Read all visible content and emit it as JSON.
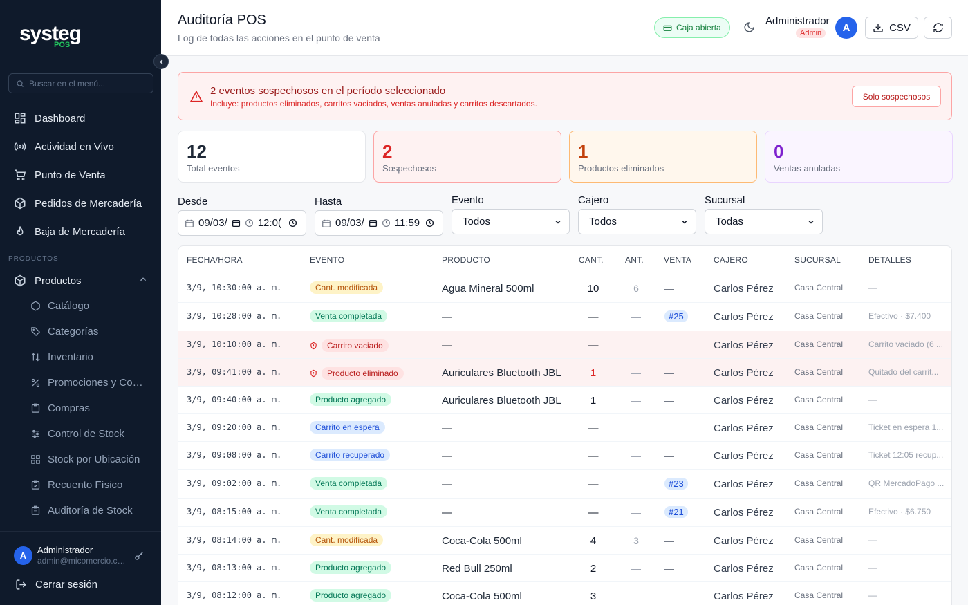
{
  "sidebar": {
    "logo_brand": "systeg",
    "logo_sub": "POS",
    "search_placeholder": "Buscar en el menú...",
    "nav": [
      "Dashboard",
      "Actividad en Vivo",
      "Punto de Venta",
      "Pedidos de Mercadería",
      "Baja de Mercadería"
    ],
    "section_label": "PRODUCTOS",
    "group_label": "Productos",
    "sub_items": [
      "Catálogo",
      "Categorías",
      "Inventario",
      "Promociones y Combos",
      "Compras",
      "Control de Stock",
      "Stock por Ubicación",
      "Recuento Físico",
      "Auditoría de Stock"
    ],
    "footer": {
      "avatar": "A",
      "name": "Administrador",
      "email": "admin@micomercio.com",
      "logout": "Cerrar sesión"
    }
  },
  "header": {
    "title": "Auditoría POS",
    "subtitle": "Log de todas las acciones en el punto de venta",
    "caja_label": "Caja abierta",
    "user_name": "Administrador",
    "user_role": "Admin",
    "avatar": "A",
    "csv_label": "CSV"
  },
  "alert": {
    "title": "2 eventos sospechosos en el período seleccionado",
    "text": "Incluye: productos eliminados, carritos vaciados, ventas anuladas y carritos descartados.",
    "button": "Solo sospechosos"
  },
  "stats": [
    {
      "value": "12",
      "label": "Total eventos",
      "color": "#1f2937"
    },
    {
      "value": "2",
      "label": "Sospechosos",
      "color": "#dc2626"
    },
    {
      "value": "1",
      "label": "Productos eliminados",
      "color": "#c2410c"
    },
    {
      "value": "0",
      "label": "Ventas anuladas",
      "color": "#7e22ce"
    }
  ],
  "filters": {
    "desde_label": "Desde",
    "desde_date": "09/03/",
    "desde_time": "12:0(",
    "hasta_label": "Hasta",
    "hasta_date": "09/03/",
    "hasta_time": "11:59",
    "evento_label": "Evento",
    "evento_value": "Todos",
    "cajero_label": "Cajero",
    "cajero_value": "Todos",
    "sucursal_label": "Sucursal",
    "sucursal_value": "Todas"
  },
  "table": {
    "headers": [
      "FECHA/HORA",
      "EVENTO",
      "PRODUCTO",
      "CANT.",
      "ANT.",
      "VENTA",
      "CAJERO",
      "SUCURSAL",
      "DETALLES"
    ],
    "rows": [
      {
        "date": "3/9, 10:30:00 a. m.",
        "event": "Cant. modificada",
        "ev_color": "yellow",
        "shield": false,
        "susp": false,
        "product": "Agua Mineral 500ml",
        "cant": "10",
        "cant_red": false,
        "ant": "6",
        "venta": "—",
        "venta_pill": false,
        "cajero": "Carlos Pérez",
        "sucursal": "Casa Central",
        "detalles": "—"
      },
      {
        "date": "3/9, 10:28:00 a. m.",
        "event": "Venta completada",
        "ev_color": "green",
        "shield": false,
        "susp": false,
        "product": "—",
        "cant": "—",
        "cant_red": false,
        "ant": "—",
        "venta": "#25",
        "venta_pill": true,
        "cajero": "Carlos Pérez",
        "sucursal": "Casa Central",
        "detalles": "Efectivo · $7.400"
      },
      {
        "date": "3/9, 10:10:00 a. m.",
        "event": "Carrito vaciado",
        "ev_color": "red",
        "shield": true,
        "susp": true,
        "product": "—",
        "cant": "—",
        "cant_red": false,
        "ant": "—",
        "venta": "—",
        "venta_pill": false,
        "cajero": "Carlos Pérez",
        "sucursal": "Casa Central",
        "detalles": "Carrito vaciado (6 ..."
      },
      {
        "date": "3/9, 09:41:00 a. m.",
        "event": "Producto eliminado",
        "ev_color": "red",
        "shield": true,
        "susp": true,
        "product": "Auriculares Bluetooth JBL",
        "cant": "1",
        "cant_red": true,
        "ant": "—",
        "venta": "—",
        "venta_pill": false,
        "cajero": "Carlos Pérez",
        "sucursal": "Casa Central",
        "detalles": "Quitado del carrit..."
      },
      {
        "date": "3/9, 09:40:00 a. m.",
        "event": "Producto agregado",
        "ev_color": "green",
        "shield": false,
        "susp": false,
        "product": "Auriculares Bluetooth JBL",
        "cant": "1",
        "cant_red": false,
        "ant": "—",
        "venta": "—",
        "venta_pill": false,
        "cajero": "Carlos Pérez",
        "sucursal": "Casa Central",
        "detalles": "—"
      },
      {
        "date": "3/9, 09:20:00 a. m.",
        "event": "Carrito en espera",
        "ev_color": "blue",
        "shield": false,
        "susp": false,
        "product": "—",
        "cant": "—",
        "cant_red": false,
        "ant": "—",
        "venta": "—",
        "venta_pill": false,
        "cajero": "Carlos Pérez",
        "sucursal": "Casa Central",
        "detalles": "Ticket en espera 1..."
      },
      {
        "date": "3/9, 09:08:00 a. m.",
        "event": "Carrito recuperado",
        "ev_color": "blue",
        "shield": false,
        "susp": false,
        "product": "—",
        "cant": "—",
        "cant_red": false,
        "ant": "—",
        "venta": "—",
        "venta_pill": false,
        "cajero": "Carlos Pérez",
        "sucursal": "Casa Central",
        "detalles": "Ticket 12:05 recup..."
      },
      {
        "date": "3/9, 09:02:00 a. m.",
        "event": "Venta completada",
        "ev_color": "green",
        "shield": false,
        "susp": false,
        "product": "—",
        "cant": "—",
        "cant_red": false,
        "ant": "—",
        "venta": "#23",
        "venta_pill": true,
        "cajero": "Carlos Pérez",
        "sucursal": "Casa Central",
        "detalles": "QR MercadoPago ..."
      },
      {
        "date": "3/9, 08:15:00 a. m.",
        "event": "Venta completada",
        "ev_color": "green",
        "shield": false,
        "susp": false,
        "product": "—",
        "cant": "—",
        "cant_red": false,
        "ant": "—",
        "venta": "#21",
        "venta_pill": true,
        "cajero": "Carlos Pérez",
        "sucursal": "Casa Central",
        "detalles": "Efectivo · $6.750"
      },
      {
        "date": "3/9, 08:14:00 a. m.",
        "event": "Cant. modificada",
        "ev_color": "yellow",
        "shield": false,
        "susp": false,
        "product": "Coca-Cola 500ml",
        "cant": "4",
        "cant_red": false,
        "ant": "3",
        "venta": "—",
        "venta_pill": false,
        "cajero": "Carlos Pérez",
        "sucursal": "Casa Central",
        "detalles": "—"
      },
      {
        "date": "3/9, 08:13:00 a. m.",
        "event": "Producto agregado",
        "ev_color": "green",
        "shield": false,
        "susp": false,
        "product": "Red Bull 250ml",
        "cant": "2",
        "cant_red": false,
        "ant": "—",
        "venta": "—",
        "venta_pill": false,
        "cajero": "Carlos Pérez",
        "sucursal": "Casa Central",
        "detalles": "—"
      },
      {
        "date": "3/9, 08:12:00 a. m.",
        "event": "Producto agregado",
        "ev_color": "green",
        "shield": false,
        "susp": false,
        "product": "Coca-Cola 500ml",
        "cant": "3",
        "cant_red": false,
        "ant": "—",
        "venta": "—",
        "venta_pill": false,
        "cajero": "Carlos Pérez",
        "sucursal": "Casa Central",
        "detalles": "—"
      }
    ]
  }
}
